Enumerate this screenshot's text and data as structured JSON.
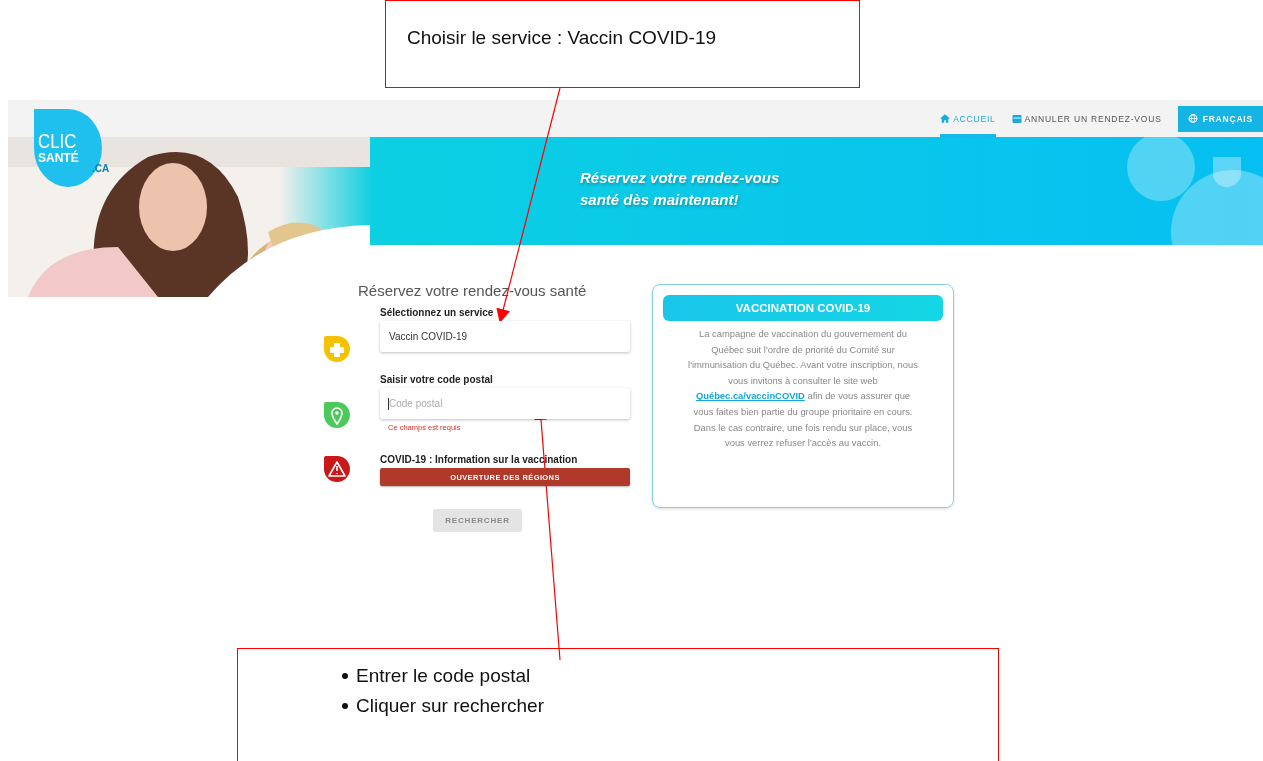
{
  "top_callout": {
    "text": "Choisir le service : Vaccin COVID-19"
  },
  "nav": [
    {
      "kind": "link",
      "label": "ACCUEIL",
      "selected": true
    },
    {
      "kind": "link",
      "label": "ANNULER UN RENDEZ-VOUS",
      "selected": false
    },
    {
      "kind": "button",
      "label": "FRANÇAIS"
    }
  ],
  "logo": {
    "line_1": "CLIC",
    "line_2": "SANTÉ",
    "line_3": ".CA"
  },
  "banner": {
    "line_1": "Réservez votre rendez-vous",
    "line_2": "santé dès maintenant!"
  },
  "form": {
    "title": "Réservez votre rendez-vous santé",
    "rows": [
      {
        "kind": "field",
        "label": "Sélectionnez un service",
        "value": "Vaccin COVID-19",
        "focused": false
      },
      {
        "kind": "field",
        "label": "Saisir votre code postal",
        "placeholder": "Code postal",
        "focused": true,
        "error": "Ce champs est requis"
      },
      {
        "kind": "notice",
        "label": "COVID-19 : Information sur la vaccination",
        "button": "OUVERTURE DES RÉGIONS"
      }
    ],
    "submit": {
      "label": "RECHERCHER",
      "disabled": true
    }
  },
  "info_card": {
    "title": "VACCINATION COVID-19",
    "text_before": "La campagne de vaccination du gouvernement du Québec suit l'ordre de priorité du Comité sur l'immunisation du Québec. Avant votre inscription, nous vous invitons à consulter le site web",
    "link": "Québec.ca/vaccinCOVID",
    "text_after": "afin de vous assurer que vous faites bien partie du groupe prioritaire en cours. Dans le cas contraire, une fois rendu sur place, vous vous verrez refuser l'accès au vaccin."
  },
  "bottom_callout": {
    "items": [
      "Entrer le code postal",
      "Cliquer sur rechercher"
    ]
  }
}
